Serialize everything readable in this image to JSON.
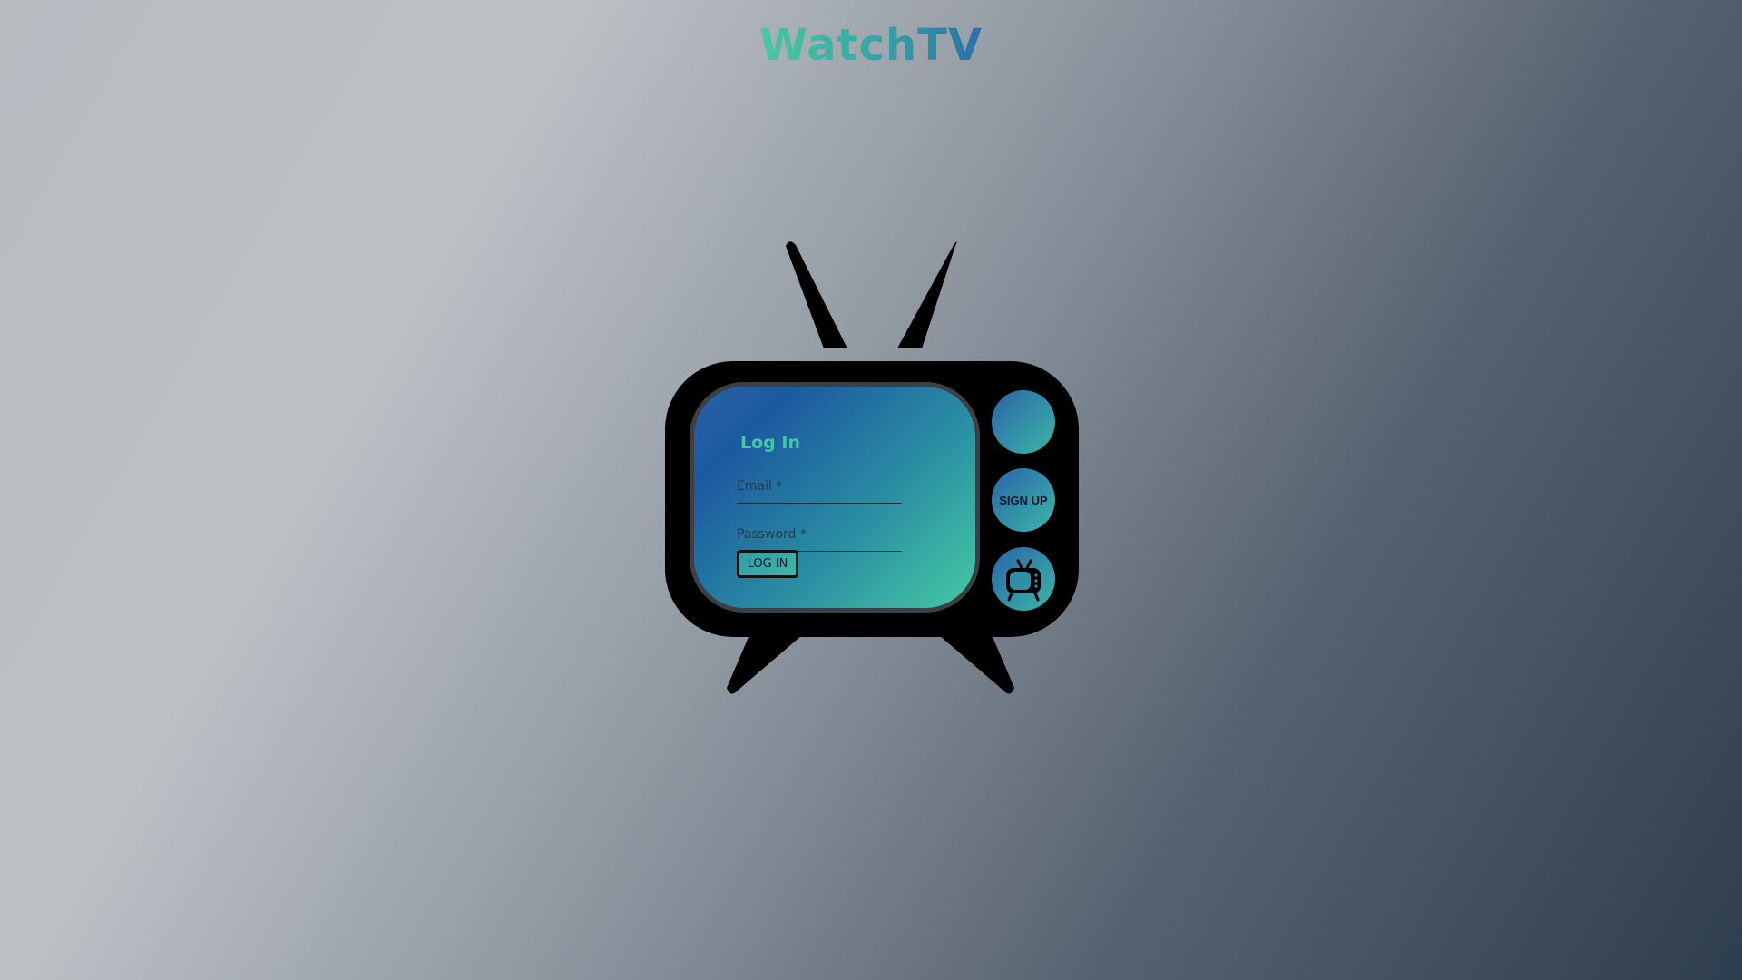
{
  "app": {
    "title": "WatchTV"
  },
  "login": {
    "title": "Log In",
    "email_label": "Email *",
    "email_value": "",
    "password_label": "Password *",
    "password_value": "",
    "submit_label": "LOG IN"
  },
  "side_buttons": {
    "top_label": "",
    "signup_label": "SIGN UP",
    "bottom_icon": "tv-icon"
  },
  "colors": {
    "accent_teal": "#45c9a0",
    "accent_blue": "#2a6fa8",
    "tv_body": "#000000"
  }
}
